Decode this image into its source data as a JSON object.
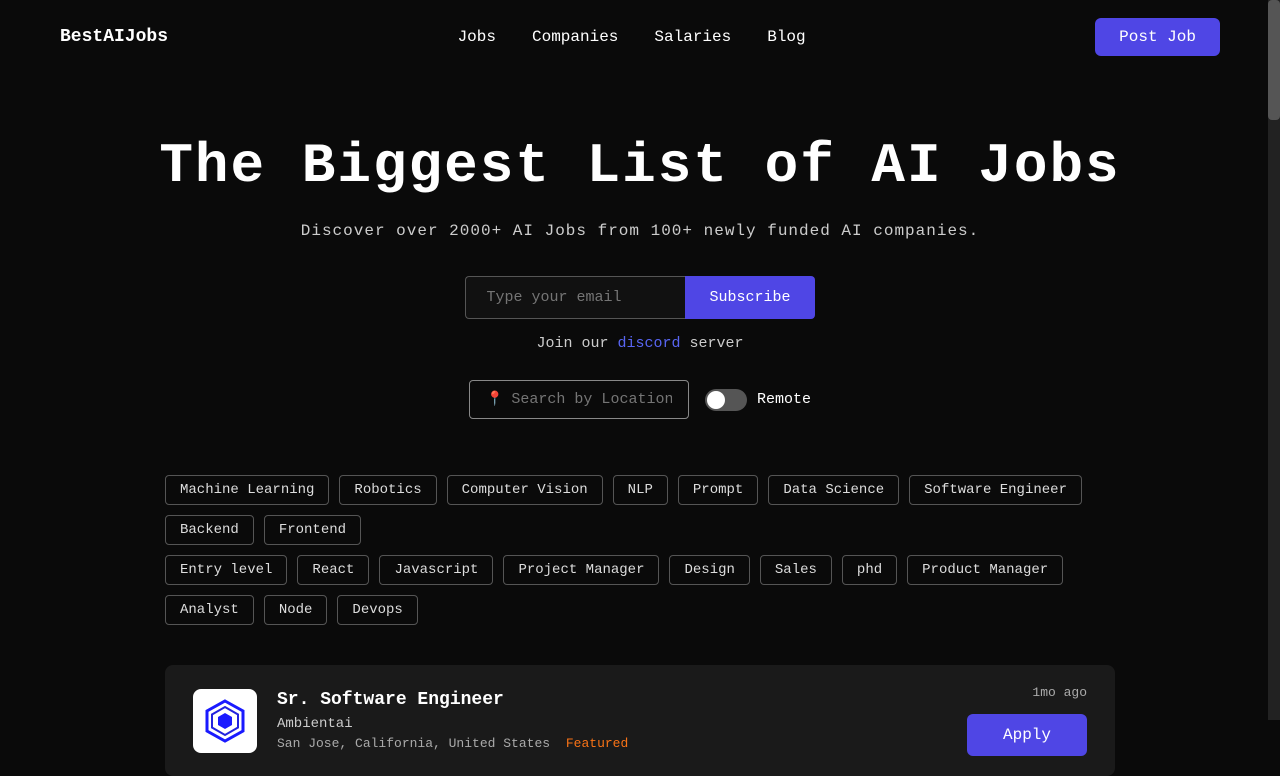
{
  "nav": {
    "brand": "BestAIJobs",
    "links": [
      "Jobs",
      "Companies",
      "Salaries",
      "Blog"
    ],
    "post_job_label": "Post Job"
  },
  "hero": {
    "title": "The Biggest List of AI Jobs",
    "subtitle": "Discover over 2000+ AI Jobs from 100+ newly funded AI companies."
  },
  "subscribe": {
    "placeholder": "Type your email",
    "button_label": "Subscribe"
  },
  "discord": {
    "text_before": "Join our",
    "link_text": "discord",
    "text_after": "server"
  },
  "location": {
    "placeholder": "Search by Location",
    "remote_label": "Remote"
  },
  "tags_row1": [
    "Machine Learning",
    "Robotics",
    "Computer Vision",
    "NLP",
    "Prompt",
    "Data Science",
    "Software Engineer",
    "Backend",
    "Frontend"
  ],
  "tags_row2": [
    "Entry level",
    "React",
    "Javascript",
    "Project Manager",
    "Design",
    "Sales",
    "phd",
    "Product Manager",
    "Analyst",
    "Node",
    "Devops"
  ],
  "job": {
    "title": "Sr. Software Engineer",
    "company": "Ambientai",
    "location": "San Jose, California, United States",
    "featured_label": "Featured",
    "time_ago": "1mo ago",
    "apply_label": "Apply"
  }
}
